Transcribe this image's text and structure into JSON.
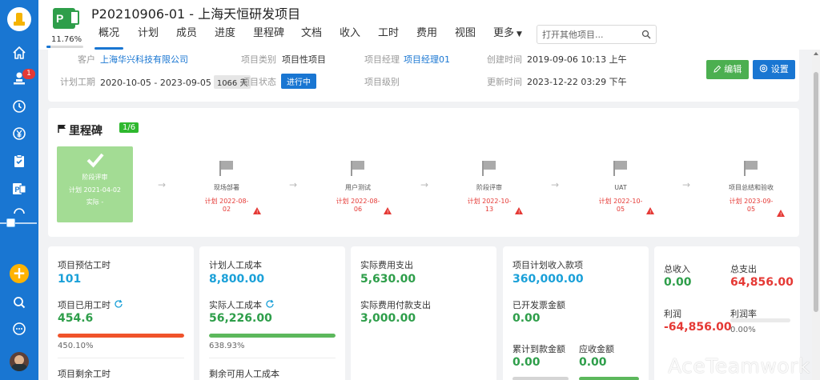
{
  "header": {
    "project_title": "P20210906-01 - 上海天恒研发项目",
    "progress_text": "11.76%",
    "progress_fraction": 0.1176,
    "tabs": [
      {
        "label": "概况",
        "active": true
      },
      {
        "label": "计划",
        "active": false
      },
      {
        "label": "成员",
        "active": false
      },
      {
        "label": "进度",
        "active": false
      },
      {
        "label": "里程碑",
        "active": false
      },
      {
        "label": "文档",
        "active": false
      },
      {
        "label": "收入",
        "active": false
      },
      {
        "label": "工时",
        "active": false
      },
      {
        "label": "费用",
        "active": false
      },
      {
        "label": "视图",
        "active": false
      },
      {
        "label": "更多",
        "active": false
      }
    ],
    "search_placeholder": "打开其他项目..."
  },
  "sidebar": {
    "items": [
      {
        "icon": "home-icon"
      },
      {
        "icon": "user-stamp-icon",
        "badge": "1"
      },
      {
        "icon": "clock-icon"
      },
      {
        "icon": "yen-icon"
      },
      {
        "icon": "clipboard-icon"
      },
      {
        "icon": "project-icon"
      },
      {
        "icon": "more-icon"
      }
    ],
    "bottom": [
      {
        "icon": "add-icon"
      },
      {
        "icon": "search-icon"
      },
      {
        "icon": "chat-icon"
      },
      {
        "icon": "avatar"
      }
    ]
  },
  "info": {
    "customer_label": "客户",
    "customer_value": "上海华兴科技有限公司",
    "type_label": "项目类别",
    "type_value": "项目性项目",
    "manager_label": "项目经理",
    "manager_value": "项目经理01",
    "created_label": "创建时间",
    "created_value": "2019-09-06 10:13 上午",
    "period_label": "计划工期",
    "period_value": "2020-10-05 - 2023-09-05",
    "period_days": "1066 天",
    "status_label": "项目状态",
    "status_value": "进行中",
    "level_label": "项目级别",
    "updated_label": "更新时间",
    "updated_value": "2023-12-22 03:29 下午",
    "edit_label": "编辑",
    "settings_label": "设置"
  },
  "milestones": {
    "title": "里程碑",
    "count": "1/6",
    "items": [
      {
        "name": "阶段评审",
        "plan": "计划 2021-04-02",
        "actual": "实际 -",
        "done": true
      },
      {
        "name": "现场部署",
        "plan": "计划 2022-08-02",
        "done": false
      },
      {
        "name": "用户测试",
        "plan": "计划 2022-08-06",
        "done": false
      },
      {
        "name": "阶段评审",
        "plan": "计划 2022-10-13",
        "done": false
      },
      {
        "name": "UAT",
        "plan": "计划 2022-10-05",
        "done": false
      },
      {
        "name": "项目总结和验收",
        "plan": "计划 2023-09-05",
        "done": false
      }
    ]
  },
  "stats": {
    "hours": {
      "est_label": "项目预估工时",
      "est_value": "101",
      "used_label": "项目已用工时",
      "used_value": "454.6",
      "used_pct": "450.10%",
      "used_fraction": 1.0,
      "remain_label": "项目剩余工时"
    },
    "labor": {
      "plan_label": "计划人工成本",
      "plan_value": "8,800.00",
      "actual_label": "实际人工成本",
      "actual_value": "56,226.00",
      "actual_pct": "638.93%",
      "actual_fraction": 1.0,
      "remain_label": "剩余可用人工成本"
    },
    "expense": {
      "spent_label": "实际费用支出",
      "spent_value": "5,630.00",
      "paid_label": "实际费用付款支出",
      "paid_value": "3,000.00"
    },
    "income": {
      "plan_label": "项目计划收入款项",
      "plan_value": "360,000.00",
      "invoiced_label": "已开发票金额",
      "invoiced_value": "0.00",
      "received_label": "累计到款金额",
      "received_value": "0.00",
      "receivable_label": "应收金额",
      "receivable_value": "0.00"
    },
    "totals": {
      "income_label": "总收入",
      "income_value": "0.00",
      "expense_label": "总支出",
      "expense_value": "64,856.00",
      "profit_label": "利润",
      "profit_value": "-64,856.00",
      "margin_label": "利润率",
      "margin_value": "0.00%"
    }
  },
  "watermark": "AceTeamwork",
  "colors": {
    "nav_blue": "#1976d2",
    "green": "#2e9e4a",
    "link_blue": "#1aa0d8",
    "red": "#e53935",
    "milestone_done": "#a3dc94"
  }
}
